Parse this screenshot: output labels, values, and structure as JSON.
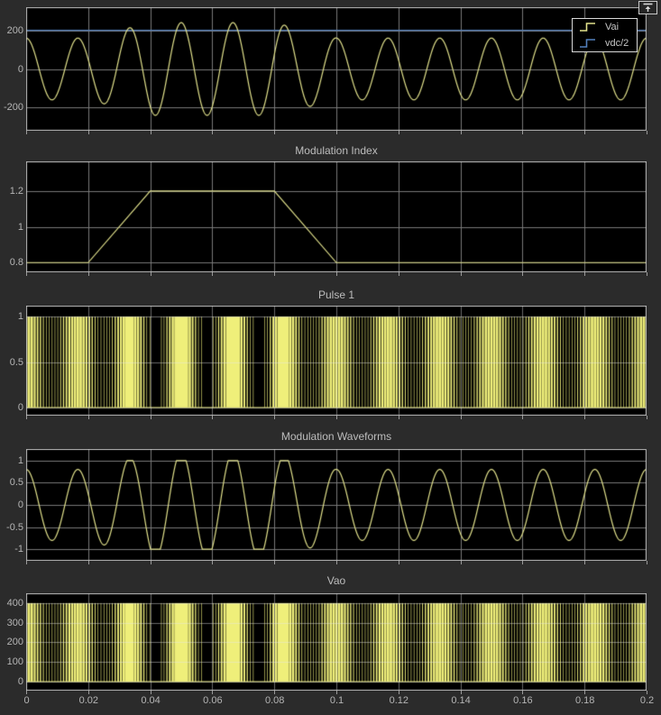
{
  "window": {
    "dock_button_icon": "dock-arrow-up-icon"
  },
  "colors": {
    "figure_background": "#2b2b2b",
    "axes_background": "#000000",
    "axes_border": "#bebebe",
    "grid": "#787878",
    "grid_overlay": "#e8e8e8",
    "tick_text": "#b5b5b5",
    "title_text": "#bdbdbd",
    "line_yellow": "#e2e28c",
    "pulse_yellow": "#efef7a",
    "line_blue": "#5380bd"
  },
  "fundamental_hz": 60,
  "carrier_hz": 1080,
  "modulation_profile": {
    "x": [
      0,
      0.02,
      0.04,
      0.08,
      0.1,
      0.2
    ],
    "y": [
      0.8,
      0.8,
      1.2,
      1.2,
      0.8,
      0.8
    ]
  },
  "xaxis": {
    "xlim": [
      0,
      0.2
    ],
    "ticks": [
      {
        "value": 0,
        "label": "0"
      },
      {
        "value": 0.02,
        "label": "0.02"
      },
      {
        "value": 0.04,
        "label": "0.04"
      },
      {
        "value": 0.06,
        "label": "0.06"
      },
      {
        "value": 0.08,
        "label": "0.08"
      },
      {
        "value": 0.1,
        "label": "0.1"
      },
      {
        "value": 0.12,
        "label": "0.12"
      },
      {
        "value": 0.14,
        "label": "0.14"
      },
      {
        "value": 0.16,
        "label": "0.16"
      },
      {
        "value": 0.18,
        "label": "0.18"
      },
      {
        "value": 0.2,
        "label": "0.2"
      }
    ]
  },
  "chart_data": [
    {
      "type": "line",
      "title": "",
      "ylim": [
        -320,
        320
      ],
      "yticks": [
        {
          "value": 200,
          "label": "200"
        },
        {
          "value": 0,
          "label": "0"
        },
        {
          "value": -200,
          "label": "-200"
        }
      ],
      "legend": {
        "position": "top-right",
        "entries": [
          "Vai",
          "vdc/2"
        ]
      },
      "series": [
        {
          "name": "vdc/2",
          "kind": "constant",
          "value": 200,
          "color": "#5380bd"
        },
        {
          "name": "Vai",
          "kind": "am_sine",
          "amplitude": 200,
          "frequency_hz": 60,
          "phase": "cos",
          "clip": null,
          "color": "#e2e28c",
          "description": "200 * m(t) * cos(2*pi*60*t), m(t) from modulation_profile"
        }
      ]
    },
    {
      "type": "line",
      "title": "Modulation Index",
      "ylim": [
        0.746,
        1.365
      ],
      "yticks": [
        {
          "value": 1.2,
          "label": "1.2"
        },
        {
          "value": 1,
          "label": "1"
        },
        {
          "value": 0.8,
          "label": "0.8"
        }
      ],
      "series": [
        {
          "name": "Modulation Index",
          "kind": "piecewise",
          "color": "#e2e28c",
          "x": [
            0,
            0.02,
            0.04,
            0.08,
            0.1,
            0.2
          ],
          "y": [
            0.8,
            0.8,
            1.2,
            1.2,
            0.8,
            0.8
          ]
        }
      ]
    },
    {
      "type": "pwm",
      "title": "Pulse 1",
      "ylim": [
        -0.09,
        1.12
      ],
      "yticks": [
        {
          "value": 1,
          "label": "1"
        },
        {
          "value": 0.5,
          "label": "0.5"
        },
        {
          "value": 0,
          "label": "0"
        }
      ],
      "series": [
        {
          "name": "Pulse 1",
          "kind": "pwm",
          "high": 1,
          "low": 0,
          "carrier_hz": 1080,
          "fundamental_hz": 60,
          "color": "#efef7a",
          "description": "SPWM: high where m(t)*cos(2*pi*60*t) >= 1080 Hz triangle carrier"
        }
      ]
    },
    {
      "type": "line",
      "title": "Modulation Waveforms",
      "ylim": [
        -1.26,
        1.26
      ],
      "yticks": [
        {
          "value": 1,
          "label": "1"
        },
        {
          "value": 0.5,
          "label": "0.5"
        },
        {
          "value": 0,
          "label": "0"
        },
        {
          "value": -0.5,
          "label": "-0.5"
        },
        {
          "value": -1,
          "label": "-1"
        }
      ],
      "series": [
        {
          "name": "Modulation Waveform",
          "kind": "am_sine",
          "amplitude": 1,
          "frequency_hz": 60,
          "phase": "cos",
          "clip": [
            -1,
            1
          ],
          "color": "#e2e28c",
          "description": "m(t)*cos(2*pi*60*t) clipped to [-1,1]"
        }
      ]
    },
    {
      "type": "pwm",
      "title": "Vao",
      "ylim": [
        -46,
        450
      ],
      "yticks": [
        {
          "value": 400,
          "label": "400"
        },
        {
          "value": 300,
          "label": "300"
        },
        {
          "value": 200,
          "label": "200"
        },
        {
          "value": 100,
          "label": "100"
        },
        {
          "value": 0,
          "label": "0"
        }
      ],
      "series": [
        {
          "name": "Vao",
          "kind": "pwm",
          "high": 400,
          "low": 0,
          "carrier_hz": 1080,
          "fundamental_hz": 60,
          "color": "#efef7a",
          "description": "Vao = 400 * Pulse1 (same SPWM pattern scaled to Vdc)"
        }
      ]
    }
  ]
}
